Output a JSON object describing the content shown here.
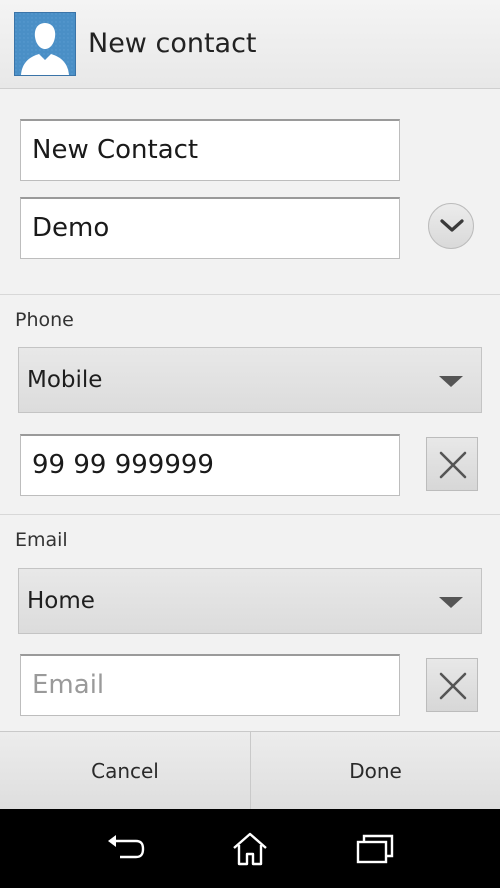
{
  "header": {
    "title": "New contact",
    "avatar_icon": "contact-avatar-icon"
  },
  "name_section": {
    "name_value": "New Contact",
    "company_value": "Demo",
    "expand_icon": "chevron-down-icon"
  },
  "phone_section": {
    "label": "Phone",
    "type_value": "Mobile",
    "number_value": "99 99 999999",
    "clear_icon": "close-icon"
  },
  "email_section": {
    "label": "Email",
    "type_value": "Home",
    "email_placeholder": "Email",
    "clear_icon": "close-icon"
  },
  "actions": {
    "cancel_label": "Cancel",
    "done_label": "Done"
  },
  "navigation": {
    "icons": [
      "back-icon",
      "home-icon",
      "recent-apps-icon"
    ]
  },
  "colors": {
    "avatar_bg": "#4a8fc6",
    "navbar_bg": "#000000"
  }
}
